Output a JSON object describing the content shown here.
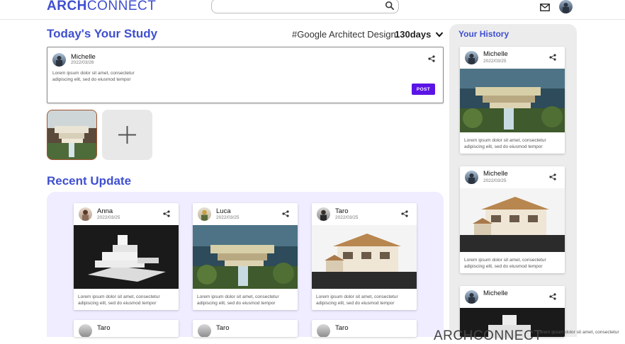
{
  "header": {
    "logo_bold": "ARCH",
    "logo_light": "CONNECT",
    "search_placeholder": ""
  },
  "study": {
    "title": "Today's Your Study",
    "course": "#Google Architect Design",
    "days": "130days"
  },
  "compose": {
    "user": "Michelle",
    "date": "2022/03/26",
    "text_line1": "Lorem ipsum dolor sit amet, consectetur",
    "text_line2": "adipiscing elit, sed do eiusmod tempor",
    "post_label": "POST"
  },
  "recent": {
    "title": "Recent Update",
    "cards": [
      {
        "user": "Anna",
        "date": "2022/03/25",
        "line1": "Lorem ipsum dolor sit amet, consectetur",
        "line2": "adipiscing elit, sed do eiusmod tempor"
      },
      {
        "user": "Luca",
        "date": "2022/03/25",
        "line1": "Lorem ipsum dolor sit amet, consectetur",
        "line2": "adipiscing elit, sed do eiusmod tempor"
      },
      {
        "user": "Taro",
        "date": "2022/03/25",
        "line1": "Lorem ipsum dolor sit amet, consectetur",
        "line2": "adipiscing elit, sed do eiusmod tempor"
      }
    ],
    "row2": [
      {
        "user": "Taro"
      },
      {
        "user": "Taro"
      },
      {
        "user": "Taro"
      }
    ]
  },
  "history": {
    "title": "Your History",
    "cards": [
      {
        "user": "Michelle",
        "date": "2022/03/25",
        "line1": "Lorem ipsum dolor sit amet, consectetur",
        "line2": "adipiscing elit, sed do eiusmod tempor"
      },
      {
        "user": "Michelle",
        "date": "2022/03/25",
        "line1": "Lorem ipsum dolor sit amet, consectetur",
        "line2": "adipiscing elit, sed do eiusmod tempor"
      },
      {
        "user": "Michelle"
      }
    ]
  },
  "footer": {
    "logo": "ARCHCONNECT",
    "text": "Lorem ipsum dolor sit amet, consectetur"
  },
  "colors": {
    "brand": "#3f4fd0",
    "post_button": "#5b14e6",
    "recent_panel": "#efedff",
    "history_panel": "#ececec"
  }
}
